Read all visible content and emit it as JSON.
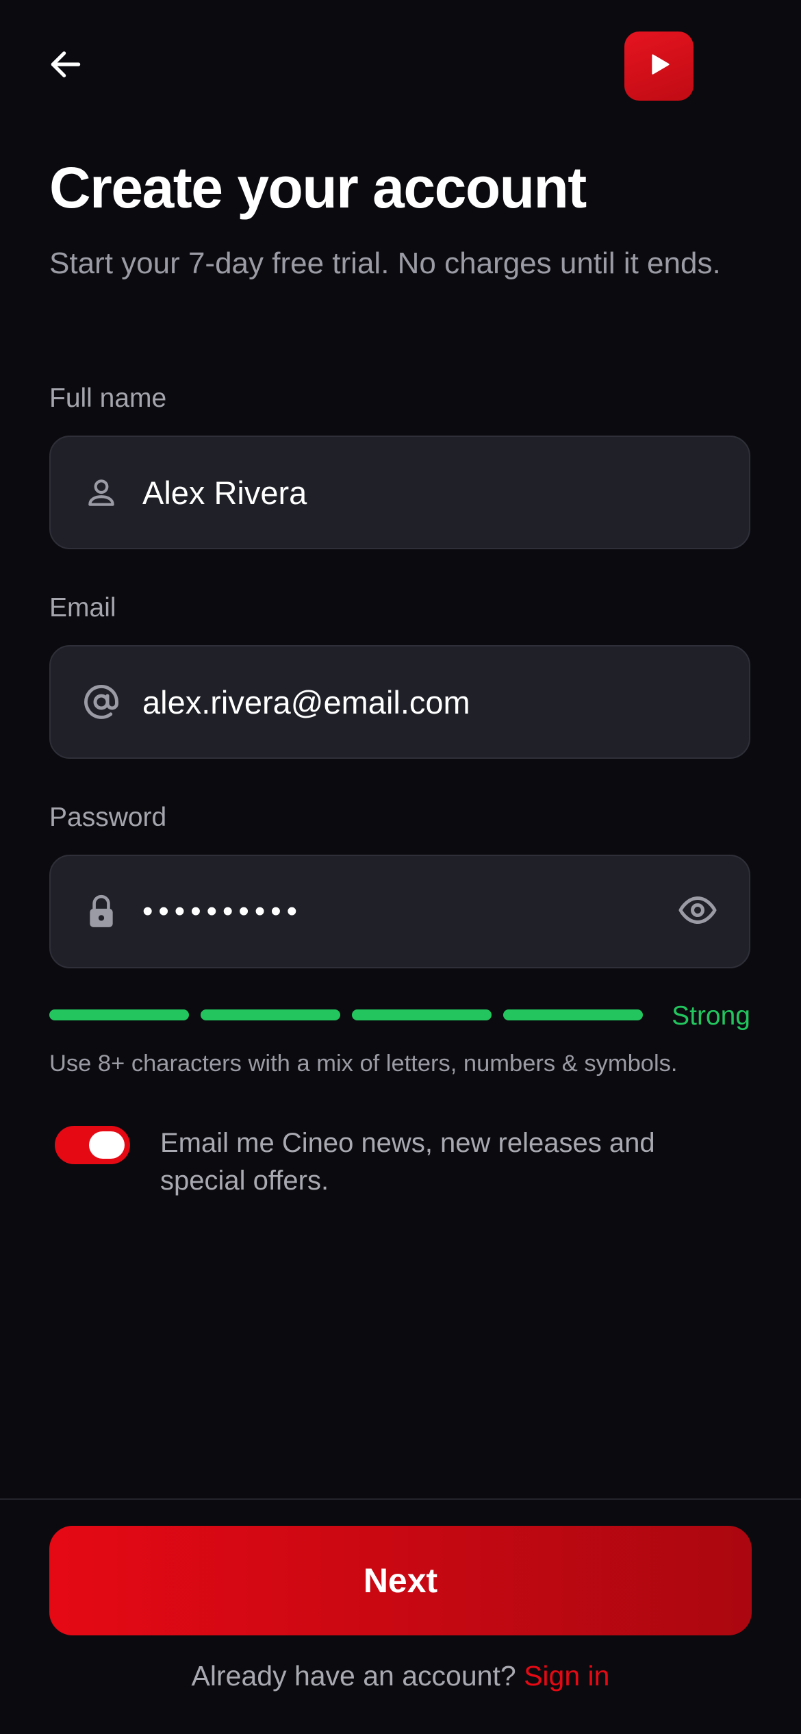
{
  "header": {
    "back_icon": "arrow-left-icon",
    "logo_icon": "play-icon",
    "logo_color": "#e50914"
  },
  "page": {
    "title": "Create your account",
    "subtitle": "Start your 7-day free trial. No charges until it ends."
  },
  "form": {
    "full_name": {
      "label": "Full name",
      "value": "Alex Rivera",
      "icon": "user-icon"
    },
    "email": {
      "label": "Email",
      "value": "alex.rivera@email.com",
      "icon": "at-sign-icon"
    },
    "password": {
      "label": "Password",
      "masked_value": "••••••••••",
      "icon": "lock-icon",
      "visibility_icon": "eye-icon",
      "strength_label": "Strong",
      "strength_level": 4,
      "strength_max": 4,
      "strength_color": "#22c55e",
      "hint": "Use 8+ characters with a mix of letters, numbers & symbols."
    },
    "marketing_opt_in": {
      "enabled": true,
      "label": "Email me Cineo news, new releases and special offers."
    }
  },
  "footer": {
    "next_label": "Next",
    "signin_prompt": "Already have an account?",
    "signin_link": "Sign in"
  },
  "colors": {
    "accent": "#e50914",
    "background": "#0b0b0f",
    "field_bg": "#1f2028",
    "success": "#22c55e"
  }
}
